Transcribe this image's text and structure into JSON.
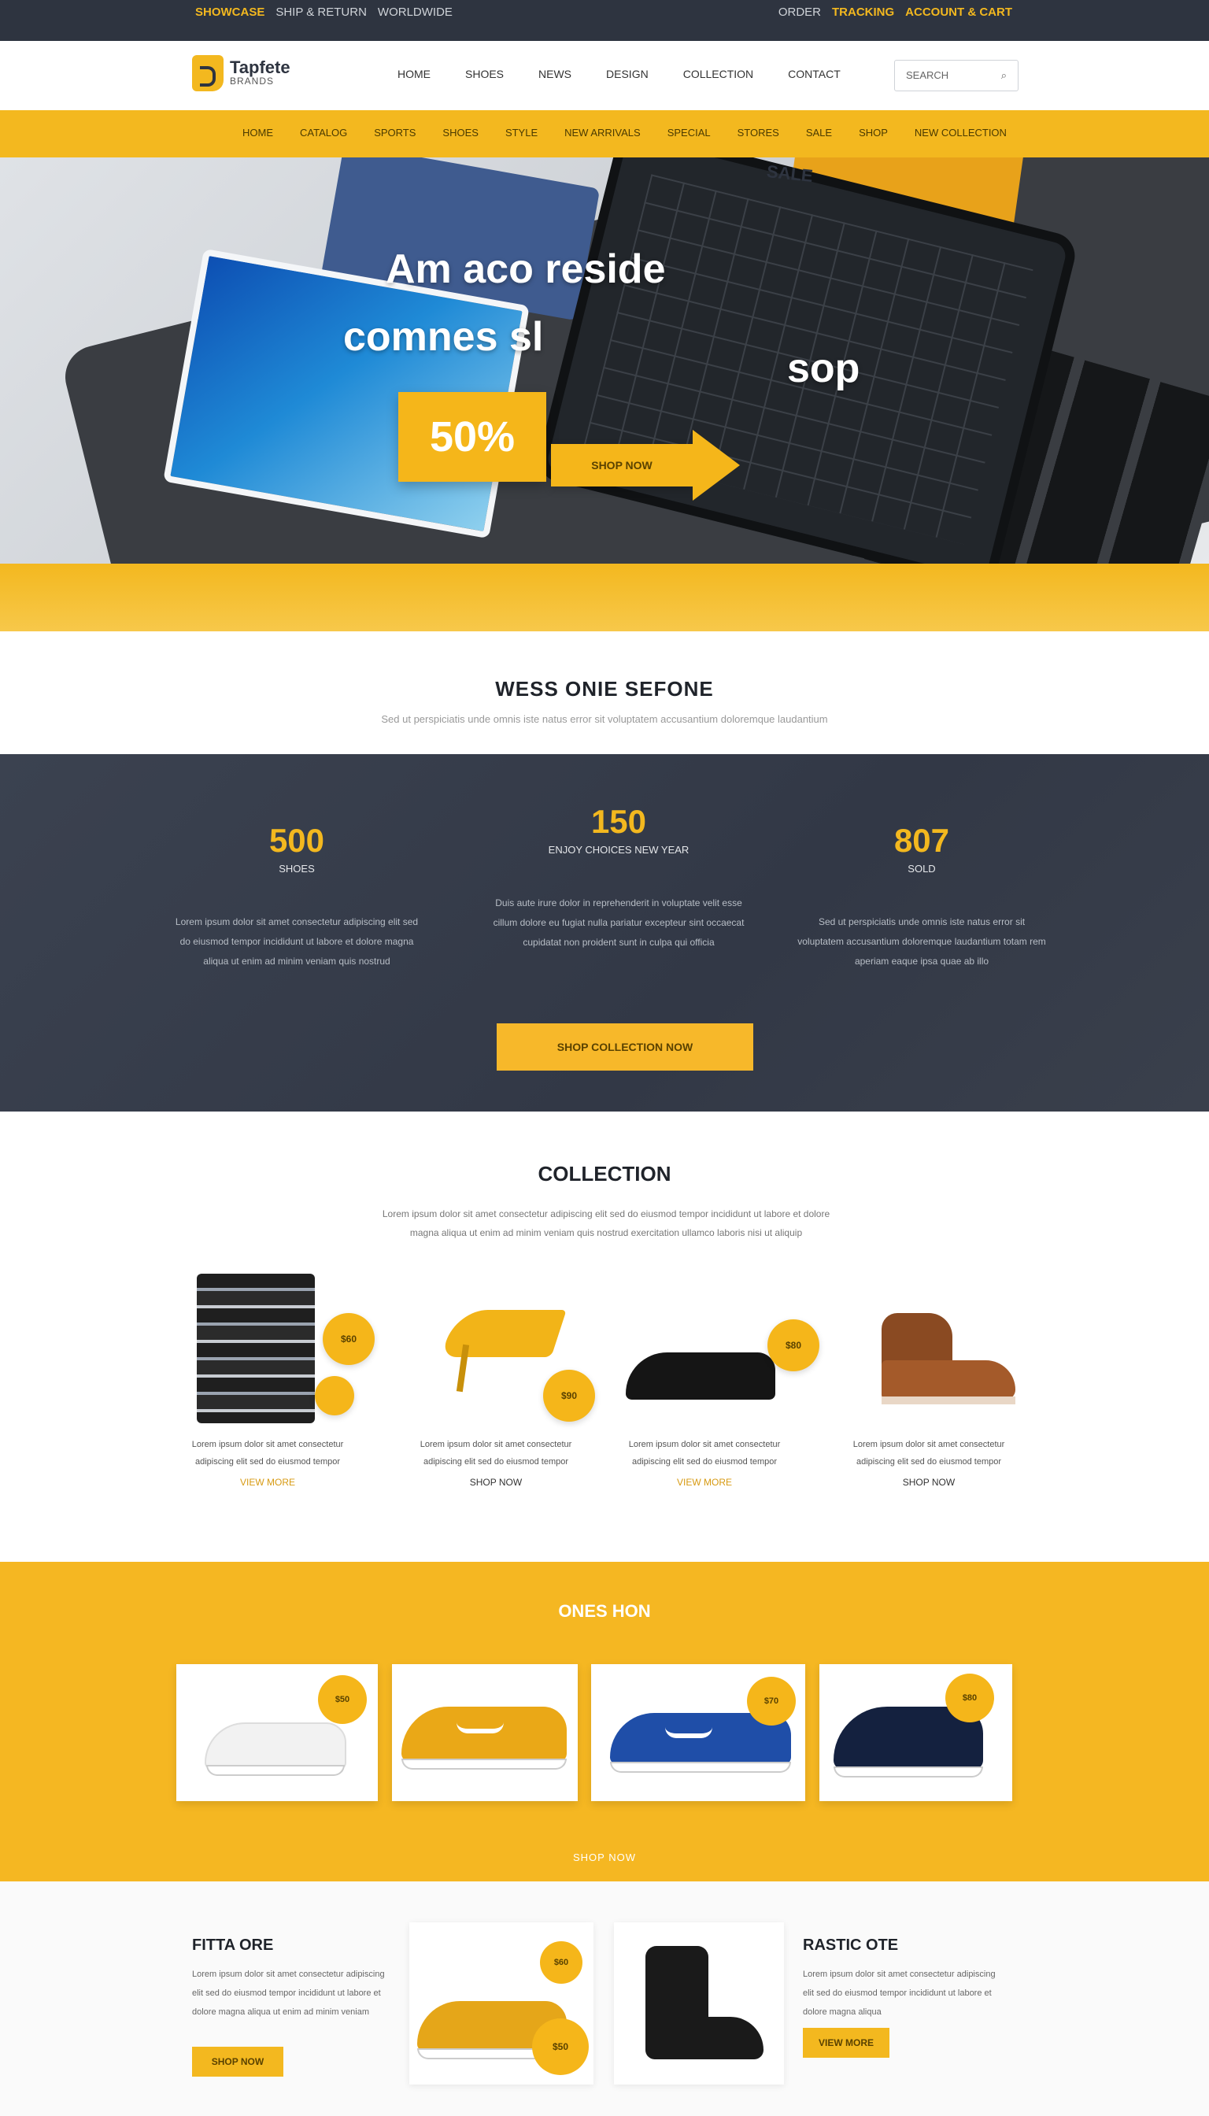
{
  "topbar": {
    "left": [
      "SHOWCASE",
      "SHIP & RETURN",
      "WORLDWIDE"
    ],
    "right": [
      "ORDER",
      "TRACKING",
      "ACCOUNT & CART"
    ]
  },
  "header": {
    "logo_name": "Tapfete",
    "logo_sub": "BRANDS",
    "nav": [
      "HOME",
      "SHOES",
      "NEWS",
      "DESIGN",
      "COLLECTION",
      "CONTACT"
    ],
    "search_placeholder": "SEARCH",
    "search_icon": "search-icon"
  },
  "subnav": {
    "items": [
      "HOME",
      "CATALOG",
      "SPORTS",
      "SHOES",
      "STYLE",
      "NEW ARRIVALS",
      "SPECIAL",
      "STORES",
      "SALE",
      "SHOP",
      "NEW COLLECTION"
    ]
  },
  "hero": {
    "label": "SALE",
    "line1": "Am aco reside",
    "line2": "comnes sl",
    "line3": "sop",
    "discount": "50%",
    "cta": "SHOP NOW"
  },
  "welcome": {
    "title": "WESS ONIE SEFONE",
    "subtitle": "Sed ut perspiciatis unde omnis iste natus error sit voluptatem accusantium doloremque laudantium"
  },
  "stats": {
    "items": [
      {
        "num": "500",
        "label": "SHOES",
        "text": "Lorem ipsum dolor sit amet consectetur adipiscing elit sed do eiusmod tempor incididunt ut labore et dolore magna aliqua ut enim ad minim veniam quis nostrud"
      },
      {
        "num": "150",
        "label": "ENJOY CHOICES NEW YEAR",
        "text": "Duis aute irure dolor in reprehenderit in voluptate velit esse cillum dolore eu fugiat nulla pariatur excepteur sint occaecat cupidatat non proident sunt in culpa qui officia"
      },
      {
        "num": "807",
        "label": "SOLD",
        "text": "Sed ut perspiciatis unde omnis iste natus error sit voluptatem accusantium doloremque laudantium totam rem aperiam eaque ipsa quae ab illo"
      }
    ],
    "button": "SHOP COLLECTION NOW"
  },
  "collection": {
    "title": "COLLECTION",
    "description": "Lorem ipsum dolor sit amet consectetur adipiscing elit sed do eiusmod tempor incididunt ut labore et dolore magna aliqua ut enim ad minim veniam quis nostrud exercitation ullamco laboris nisi ut aliquip",
    "products": [
      {
        "price": "$60",
        "text": "Lorem ipsum dolor sit amet consectetur adipiscing elit sed do eiusmod tempor",
        "link": "VIEW MORE"
      },
      {
        "price": "$90",
        "text": "Lorem ipsum dolor sit amet consectetur adipiscing elit sed do eiusmod tempor",
        "link": "SHOP NOW"
      },
      {
        "price": "$80",
        "text": "Lorem ipsum dolor sit amet consectetur adipiscing elit sed do eiusmod tempor",
        "link": "VIEW MORE"
      },
      {
        "price": "",
        "text": "Lorem ipsum dolor sit amet consectetur adipiscing elit sed do eiusmod tempor",
        "link": "SHOP NOW"
      }
    ]
  },
  "showcase": {
    "title": "ONES HON",
    "prices": [
      "$50",
      "",
      "$70",
      "$80"
    ],
    "caption": "SHOP NOW"
  },
  "features": {
    "left_title": "FITTA ORE",
    "left_text": "Lorem ipsum dolor sit amet consectetur adipiscing elit sed do eiusmod tempor incididunt ut labore et dolore magna aliqua ut enim ad minim veniam",
    "left_button": "SHOP NOW",
    "right_title": "RASTIC OTE",
    "right_text": "Lorem ipsum dolor sit amet consectetur adipiscing elit sed do eiusmod tempor incididunt ut labore et dolore magna aliqua",
    "right_button": "VIEW MORE",
    "card_price_top": "$60",
    "card_price_bottom": "$50"
  }
}
